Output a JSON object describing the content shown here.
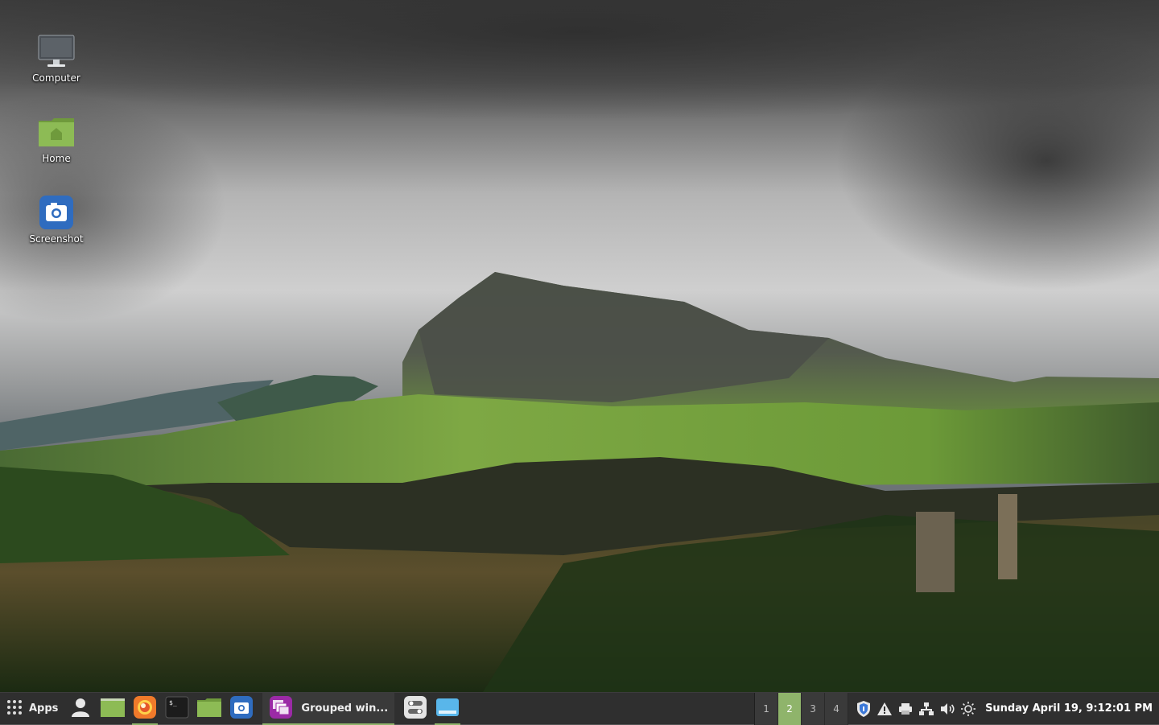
{
  "desktop": {
    "icons": [
      {
        "label": "Computer",
        "icon": "computer-icon"
      },
      {
        "label": "Home",
        "icon": "home-folder-icon"
      },
      {
        "label": "Screenshot",
        "icon": "screenshot-app-icon"
      }
    ]
  },
  "panel": {
    "menu_label": "Apps",
    "launchers": [
      {
        "name": "user-accounts",
        "icon": "user-icon"
      },
      {
        "name": "files",
        "icon": "file-manager-icon"
      },
      {
        "name": "firefox",
        "icon": "firefox-icon"
      },
      {
        "name": "terminal",
        "icon": "terminal-icon"
      },
      {
        "name": "folder",
        "icon": "folder-icon"
      },
      {
        "name": "screenshot",
        "icon": "screenshot-icon"
      }
    ],
    "grouped_window_label": "Grouped win...",
    "workspaces": [
      "1",
      "2",
      "3",
      "4"
    ],
    "current_workspace": "2",
    "clock": "Sunday April 19,  9:12:01 PM"
  },
  "colors": {
    "panel_bg": "#2f2f2f",
    "accent": "#8fb46b"
  }
}
